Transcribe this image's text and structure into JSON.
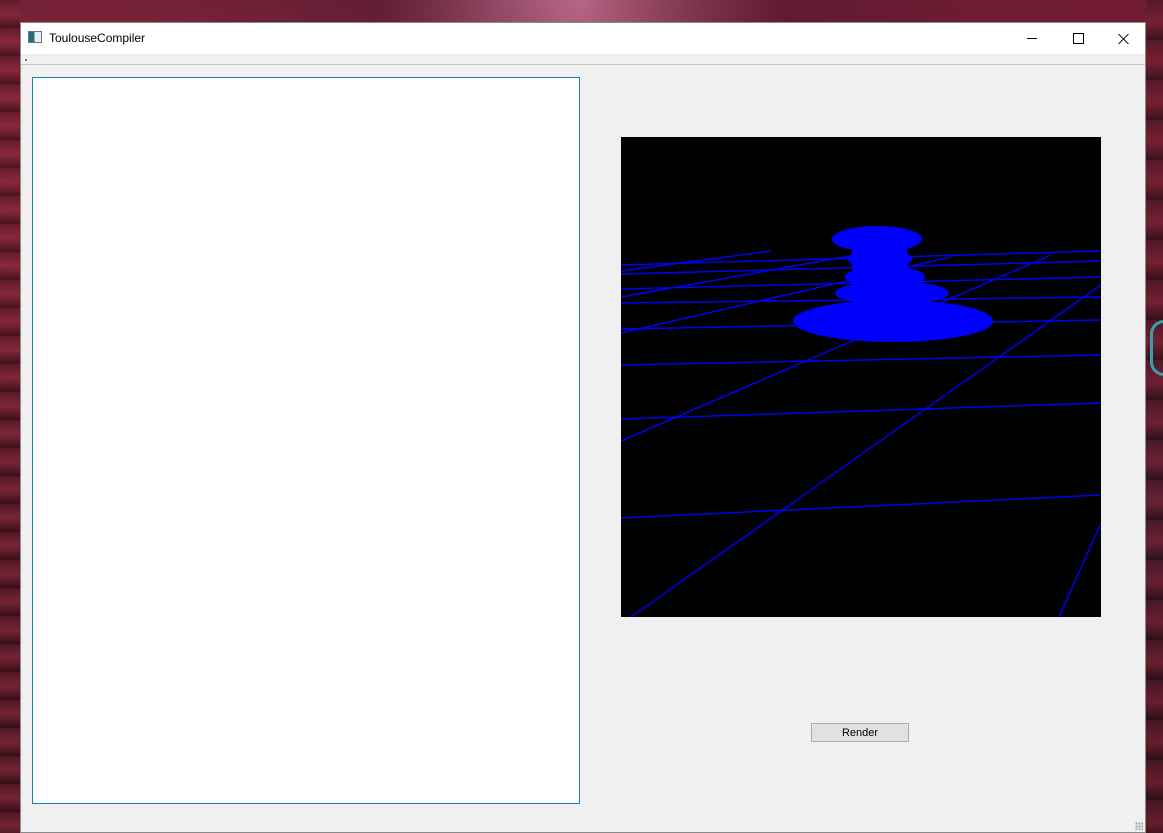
{
  "window": {
    "title": "ToulouseCompiler",
    "app_icon": "app-window-icon",
    "controls": {
      "minimize_icon": "minimize-icon",
      "maximize_icon": "maximize-icon",
      "close_icon": "close-icon"
    }
  },
  "editor": {
    "value": ""
  },
  "viewport": {
    "background_color": "#000000",
    "grid_color": "#0000ff",
    "object_color": "#0000ff"
  },
  "render_button": {
    "label": "Render"
  }
}
